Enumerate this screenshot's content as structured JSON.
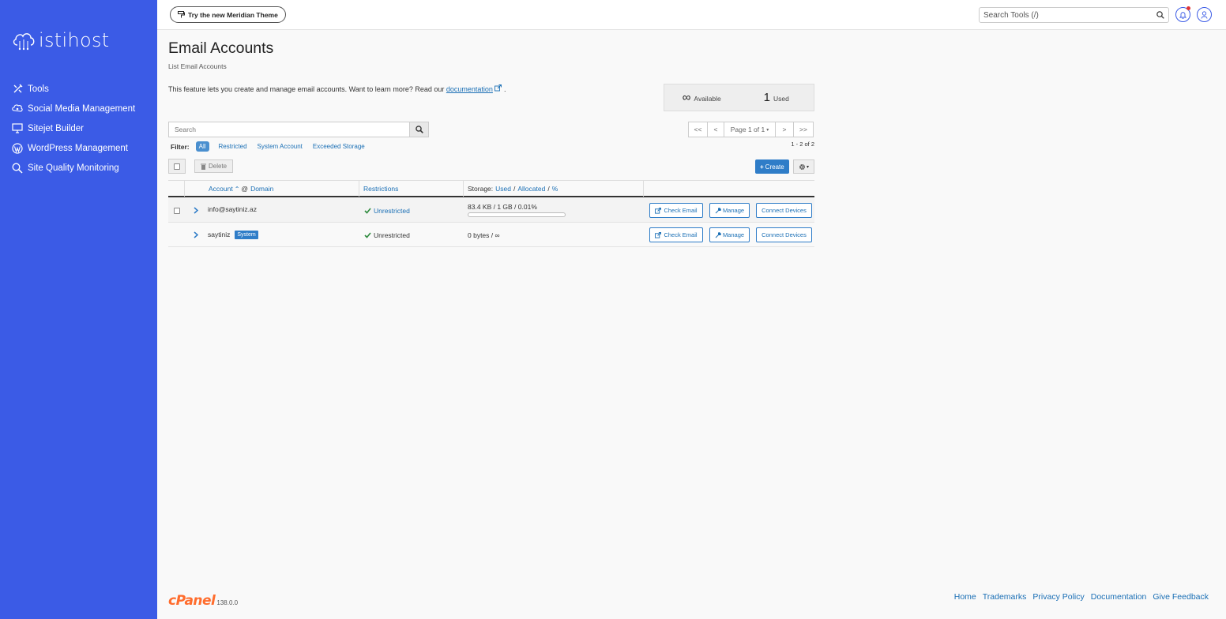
{
  "brand": {
    "name": "istihost"
  },
  "sidebar": {
    "items": [
      {
        "label": "Tools",
        "icon": "tools-icon"
      },
      {
        "label": "Social Media Management",
        "icon": "social-icon"
      },
      {
        "label": "Sitejet Builder",
        "icon": "monitor-icon"
      },
      {
        "label": "WordPress Management",
        "icon": "wordpress-icon"
      },
      {
        "label": "Site Quality Monitoring",
        "icon": "magnifier-icon"
      }
    ]
  },
  "topbar": {
    "theme_button": "Try the new Meridian Theme",
    "search_placeholder": "Search Tools (/)"
  },
  "page": {
    "title": "Email Accounts",
    "subtitle": "List Email Accounts",
    "description": "This feature lets you create and manage email accounts. Want to learn more? Read our",
    "doc_link": "documentation",
    "desc_end": "."
  },
  "stats": {
    "available_value": "∞",
    "available_label": "Available",
    "used_value": "1",
    "used_label": "Used"
  },
  "search": {
    "placeholder": "Search"
  },
  "pager": {
    "first": "<<",
    "prev": "<",
    "page": "Page 1 of 1",
    "next": ">",
    "last": ">>",
    "range": "1 - 2 of 2"
  },
  "filter": {
    "label": "Filter:",
    "options": [
      "All",
      "Restricted",
      "System Account",
      "Exceeded Storage"
    ],
    "active": "All"
  },
  "toolbar": {
    "delete": "Delete",
    "create": "Create"
  },
  "table": {
    "headers": {
      "account": "Account",
      "at": "@",
      "domain": "Domain",
      "restrictions": "Restrictions",
      "storage": "Storage:",
      "used": "Used",
      "sep": "/",
      "allocated": "Allocated",
      "percent": "%"
    },
    "rows": [
      {
        "account": "info@saytiniz.az",
        "restriction": "Unrestricted",
        "storage": "83.4 KB / 1 GB / 0.01%",
        "usage_fraction": 0.0001
      },
      {
        "account": "saytiniz",
        "badge": "System",
        "restriction": "Unrestricted",
        "storage": "0 bytes / ∞"
      }
    ],
    "actions": {
      "check": "Check Email",
      "manage": "Manage",
      "connect": "Connect Devices"
    }
  },
  "footer": {
    "logo": "cPanel",
    "version": "138.0.0",
    "links": [
      "Home",
      "Trademarks",
      "Privacy Policy",
      "Documentation",
      "Give Feedback"
    ]
  },
  "colors": {
    "sidebar": "#3b5be6",
    "accent": "#2f7dc8",
    "cpanel_orange": "#ff6c2c"
  }
}
